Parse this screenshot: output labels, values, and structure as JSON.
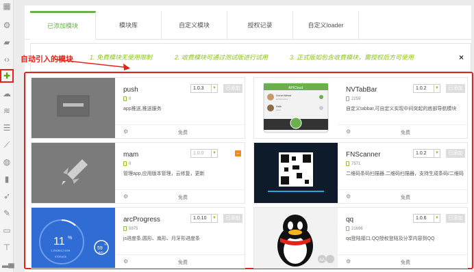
{
  "sidebar": {
    "icons": [
      "grid-icon",
      "gear-icon",
      "document-icon",
      "code-icon",
      "puzzle-icon",
      "cloud-icon",
      "layers-icon",
      "sliders-icon",
      "chart-icon",
      "database-icon",
      "bookmark-icon",
      "rocket-icon",
      "wrench-icon",
      "monitor-icon",
      "presentation-icon",
      "bar-chart-icon"
    ]
  },
  "tabs": [
    {
      "label": "已添加模块",
      "active": true
    },
    {
      "label": "模块库",
      "active": false
    },
    {
      "label": "自定义模块",
      "active": false
    },
    {
      "label": "授权记录",
      "active": false
    },
    {
      "label": "自定义loader",
      "active": false
    }
  ],
  "notice": {
    "item1": "1. 免费模块无使用限制",
    "item2": "2. 收费模块可通过测试版进行试用",
    "item3": "3. 正式版如包含收费模块，需授权后方可使用",
    "close": "×"
  },
  "annotation": "自动引入的模块",
  "modules": [
    {
      "name": "push",
      "version": "1.0.3",
      "add": "已添加",
      "count": "0",
      "desc": "app推送,推送服务",
      "price": "免费"
    },
    {
      "name": "NVTabBar",
      "version": "1.0.2",
      "add": "已添加",
      "count": "2259",
      "desc": "自定义tabbar,可自定义实现中间突起的底部导航模块",
      "price": "免费"
    },
    {
      "name": "mam",
      "version": "1.0.0",
      "add": "–",
      "count": "0",
      "desc": "管理app,应用版本管理，云修复，更新",
      "price": "免费"
    },
    {
      "name": "FNScanner",
      "version": "1.0.2",
      "add": "已添加",
      "count": "7571",
      "desc": "二维码条码扫描器,二维码扫描器，支持生成条码/二维码",
      "price": "免费"
    },
    {
      "name": "arcProgress",
      "version": "1.0.10",
      "add": "已添加",
      "count": "5975",
      "desc": "js进度条,圆形、扇形、月牙形进度条",
      "price": "免费"
    },
    {
      "name": "qq",
      "version": "1.0.6",
      "add": "已添加",
      "count": "21696",
      "desc": "qq登陆接口,QQ授权登陆及分享内容到QQ",
      "price": "免费"
    }
  ],
  "thumbs": {
    "nvtab": {
      "title": "APICloud",
      "user1": "Lionel Messi",
      "user1_sub": "El Barcelona",
      "user2": "Hulk",
      "user2_sub": "Zenit"
    },
    "arc": {
      "percent": "11",
      "unit": "%",
      "sub": "1.29GB/12.5GB",
      "label": "STORAGE",
      "small": "59",
      "small_unit": "%",
      "small_label": "RAM"
    },
    "qq": {
      "badge": "AA"
    }
  },
  "colors": {
    "accent": "#6ab04c",
    "annotation": "#e2231a",
    "notice": "#8dc21f"
  }
}
